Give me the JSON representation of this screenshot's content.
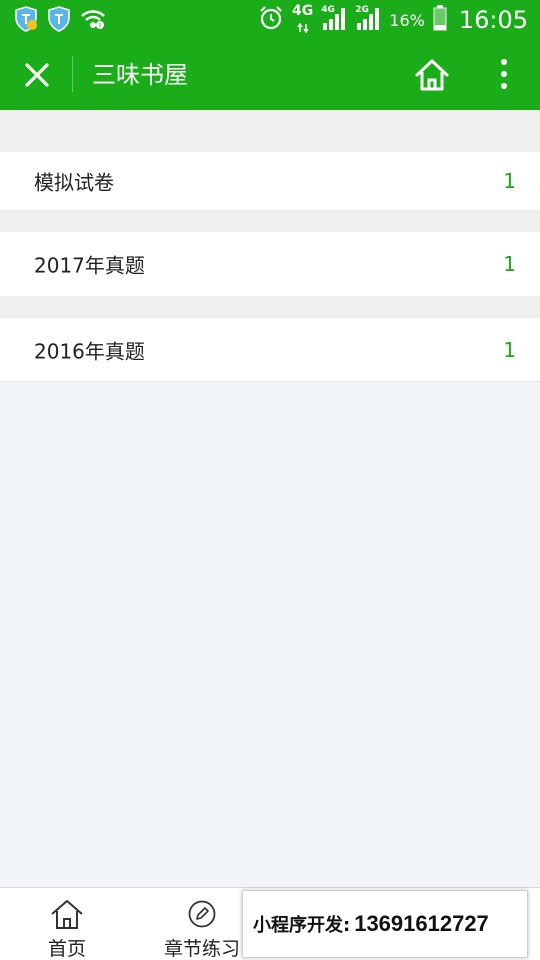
{
  "status_bar": {
    "network_4g": "4G",
    "sim1": "4G",
    "sim2": "2G",
    "battery": "16%",
    "time": "16:05"
  },
  "nav_bar": {
    "title": "三味书屋"
  },
  "list": [
    {
      "label": "模拟试卷",
      "count": "1"
    },
    {
      "label": "2017年真题",
      "count": "1"
    },
    {
      "label": "2016年真题",
      "count": "1"
    }
  ],
  "tab_bar": {
    "tabs": [
      {
        "label": "首页",
        "icon": "home-icon"
      },
      {
        "label": "章节练习",
        "icon": "pencil-icon"
      }
    ]
  },
  "promo": {
    "label": "小程序开发:",
    "phone": "13691612727"
  },
  "colors": {
    "brand": "#1aad19",
    "background": "#f2f5f8",
    "count": "#1aad19"
  }
}
